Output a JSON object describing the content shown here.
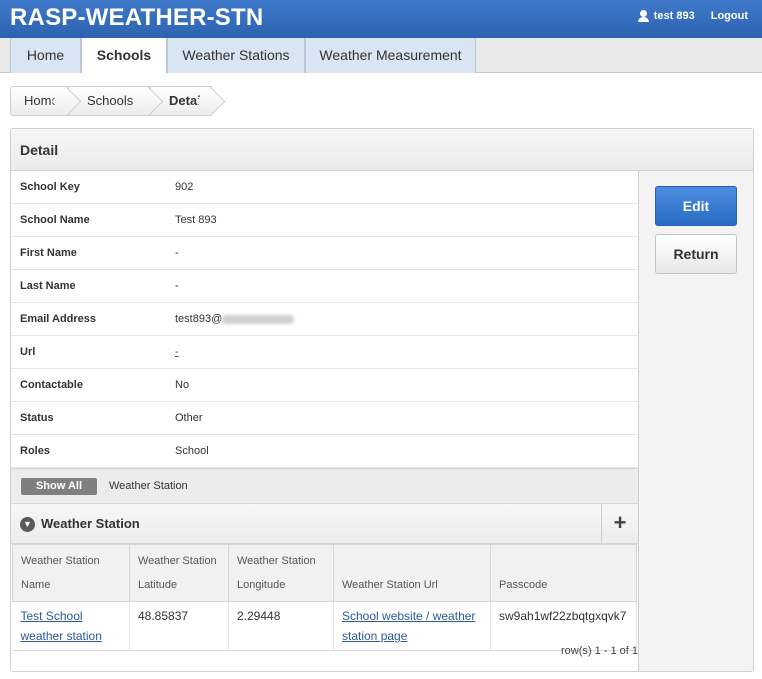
{
  "header": {
    "app_title": "RASP-WEATHER-STN",
    "user": "test 893",
    "logout": "Logout",
    "user_icon": "person-icon"
  },
  "tabs": [
    {
      "label": "Home",
      "active": false
    },
    {
      "label": "Schools",
      "active": true
    },
    {
      "label": "Weather Stations",
      "active": false
    },
    {
      "label": "Weather Measurement",
      "active": false
    }
  ],
  "breadcrumb": [
    "Home",
    "Schools",
    "Detail"
  ],
  "region": {
    "title": "Detail",
    "fields": [
      {
        "label": "School Key",
        "value": "902"
      },
      {
        "label": "School Name",
        "value": "Test 893"
      },
      {
        "label": "First Name",
        "value": "-"
      },
      {
        "label": "Last Name",
        "value": "-"
      },
      {
        "label": "Email Address",
        "value": "test893@"
      },
      {
        "label": "Url",
        "value": "-"
      },
      {
        "label": "Contactable",
        "value": "No"
      },
      {
        "label": "Status",
        "value": "Other"
      },
      {
        "label": "Roles",
        "value": "School"
      }
    ],
    "buttons": {
      "edit": "Edit",
      "return": "Return"
    }
  },
  "show_all": {
    "button": "Show All",
    "label": "Weather Station"
  },
  "sub_region": {
    "title": "Weather Station",
    "add_icon": "plus-icon",
    "collapse_icon": "chevron-down-icon",
    "columns": [
      {
        "line1": "Weather Station",
        "line2": "Name"
      },
      {
        "line1": "Weather Station",
        "line2": "Latitude"
      },
      {
        "line1": "Weather Station",
        "line2": "Longitude"
      },
      {
        "line1": "",
        "line2": "Weather Station Url"
      },
      {
        "line1": "",
        "line2": "Passcode"
      }
    ],
    "rows": [
      {
        "name": "Test School weather station",
        "latitude": "48.85837",
        "longitude": "2.29448",
        "url": "School website / weather station page",
        "passcode": "sw9ah1wf22zbqtgxqvk7"
      }
    ],
    "pagination": "row(s) 1 - 1 of 1"
  }
}
